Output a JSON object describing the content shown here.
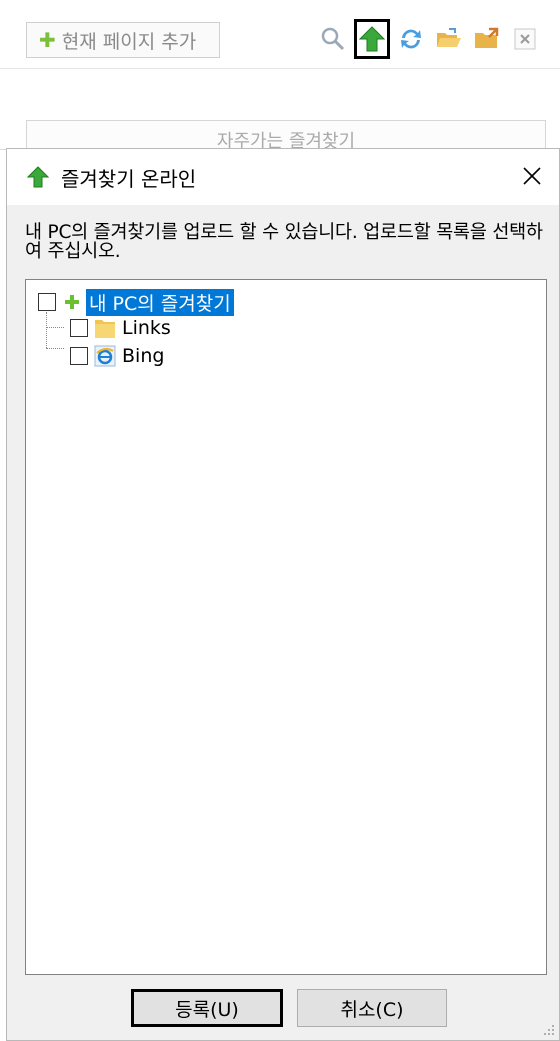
{
  "background": {
    "add_page_label": "현재 페이지 추가",
    "frequent_label": "자주가는 즐겨찾기",
    "toolbar_icons": [
      "search-icon",
      "upload-arrow-icon",
      "sync-icon",
      "folder-open-icon",
      "folder-export-icon",
      "close-box-icon"
    ]
  },
  "dialog": {
    "title": "즐겨찾기 온라인",
    "description": "내 PC의 즐겨찾기를 업로드 할 수 있습니다. 업로드할 목록을 선택하여 주십시오.",
    "tree": {
      "root": "내 PC의 즐겨찾기",
      "items": [
        "Links",
        "Bing"
      ]
    },
    "ok_label": "등록(U)",
    "cancel_label": "취소(C)"
  },
  "colors": {
    "accent_green": "#3aa83a",
    "selection_blue": "#0078d7"
  }
}
